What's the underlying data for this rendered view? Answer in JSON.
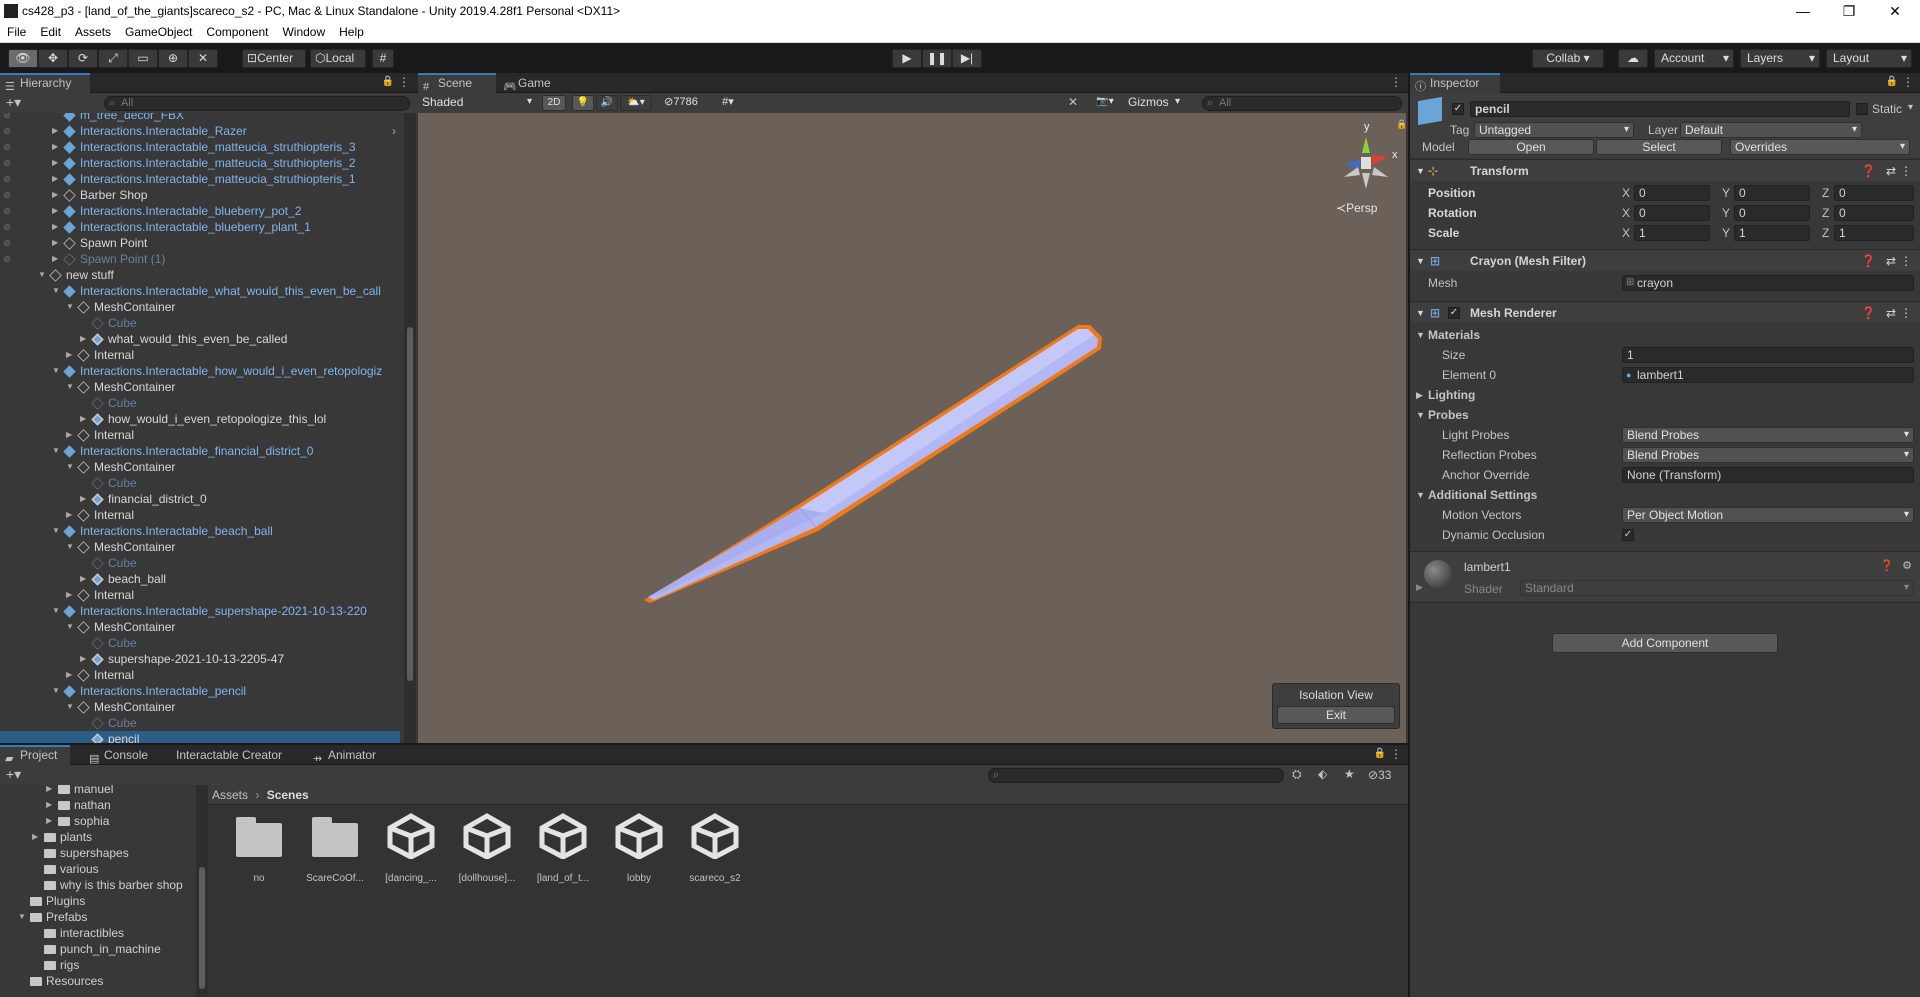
{
  "window": {
    "title": "cs428_p3 - [land_of_the_giants]scareco_s2 - PC, Mac & Linux Standalone - Unity 2019.4.28f1 Personal <DX11>",
    "minimize": "—",
    "maximize": "❐",
    "close": "✕"
  },
  "menu": [
    "File",
    "Edit",
    "Assets",
    "GameObject",
    "Component",
    "Window",
    "Help"
  ],
  "toolbar": {
    "center_label": "Center",
    "local_label": "Local",
    "collab_label": "Collab ▾",
    "account_label": "Account",
    "layers_label": "Layers",
    "layout_label": "Layout"
  },
  "hierarchy": {
    "tab_label": "Hierarchy",
    "search_placeholder": "All",
    "rows": [
      {
        "label": "m_tree_decor_FBX",
        "indent": 1,
        "style": "blue",
        "arrow": "",
        "icon": "prefab"
      },
      {
        "label": "Interactions.Interactable_Razer",
        "indent": 1,
        "style": "blue",
        "arrow": "▶",
        "icon": "prefab"
      },
      {
        "label": "Interactions.Interactable_matteucia_struthiopteris_3",
        "indent": 1,
        "style": "blue",
        "arrow": "▶",
        "icon": "prefab"
      },
      {
        "label": "Interactions.Interactable_matteucia_struthiopteris_2",
        "indent": 1,
        "style": "blue",
        "arrow": "▶",
        "icon": "prefab"
      },
      {
        "label": "Interactions.Interactable_matteucia_struthiopteris_1",
        "indent": 1,
        "style": "blue",
        "arrow": "▶",
        "icon": "prefab"
      },
      {
        "label": "Barber Shop",
        "indent": 1,
        "style": "white",
        "arrow": "▶",
        "icon": "object"
      },
      {
        "label": "Interactions.Interactable_blueberry_pot_2",
        "indent": 1,
        "style": "blue",
        "arrow": "▶",
        "icon": "prefab"
      },
      {
        "label": "Interactions.Interactable_blueberry_plant_1",
        "indent": 1,
        "style": "blue",
        "arrow": "▶",
        "icon": "prefab"
      },
      {
        "label": "Spawn Point",
        "indent": 1,
        "style": "white",
        "arrow": "▶",
        "icon": "object"
      },
      {
        "label": "Spawn Point (1)",
        "indent": 1,
        "style": "disabled",
        "arrow": "▶",
        "icon": "object"
      },
      {
        "label": "new stuff",
        "indent": 0,
        "style": "white",
        "arrow": "▼",
        "icon": "object"
      },
      {
        "label": "Interactions.Interactable_what_would_this_even_be_call",
        "indent": 1,
        "style": "blue",
        "arrow": "▼",
        "icon": "prefab"
      },
      {
        "label": "MeshContainer",
        "indent": 2,
        "style": "white",
        "arrow": "▼",
        "icon": "object"
      },
      {
        "label": "Cube",
        "indent": 3,
        "style": "disabled",
        "arrow": "",
        "icon": "object"
      },
      {
        "label": "what_would_this_even_be_called",
        "indent": 3,
        "style": "white",
        "arrow": "▶",
        "icon": "model"
      },
      {
        "label": "Internal",
        "indent": 2,
        "style": "white",
        "arrow": "▶",
        "icon": "object"
      },
      {
        "label": "Interactions.Interactable_how_would_i_even_retopologiz",
        "indent": 1,
        "style": "blue",
        "arrow": "▼",
        "icon": "prefab"
      },
      {
        "label": "MeshContainer",
        "indent": 2,
        "style": "white",
        "arrow": "▼",
        "icon": "object"
      },
      {
        "label": "Cube",
        "indent": 3,
        "style": "disabled",
        "arrow": "",
        "icon": "object"
      },
      {
        "label": "how_would_i_even_retopologize_this_lol",
        "indent": 3,
        "style": "white",
        "arrow": "▶",
        "icon": "model"
      },
      {
        "label": "Internal",
        "indent": 2,
        "style": "white",
        "arrow": "▶",
        "icon": "object"
      },
      {
        "label": "Interactions.Interactable_financial_district_0",
        "indent": 1,
        "style": "blue",
        "arrow": "▼",
        "icon": "prefab"
      },
      {
        "label": "MeshContainer",
        "indent": 2,
        "style": "white",
        "arrow": "▼",
        "icon": "object"
      },
      {
        "label": "Cube",
        "indent": 3,
        "style": "disabled",
        "arrow": "",
        "icon": "object"
      },
      {
        "label": "financial_district_0",
        "indent": 3,
        "style": "white",
        "arrow": "▶",
        "icon": "model"
      },
      {
        "label": "Internal",
        "indent": 2,
        "style": "white",
        "arrow": "▶",
        "icon": "object"
      },
      {
        "label": "Interactions.Interactable_beach_ball",
        "indent": 1,
        "style": "blue",
        "arrow": "▼",
        "icon": "prefab"
      },
      {
        "label": "MeshContainer",
        "indent": 2,
        "style": "white",
        "arrow": "▼",
        "icon": "object"
      },
      {
        "label": "Cube",
        "indent": 3,
        "style": "disabled",
        "arrow": "",
        "icon": "object"
      },
      {
        "label": "beach_ball",
        "indent": 3,
        "style": "white",
        "arrow": "▶",
        "icon": "model"
      },
      {
        "label": "Internal",
        "indent": 2,
        "style": "white",
        "arrow": "▶",
        "icon": "object"
      },
      {
        "label": "Interactions.Interactable_supershape-2021-10-13-220",
        "indent": 1,
        "style": "blue",
        "arrow": "▼",
        "icon": "prefab"
      },
      {
        "label": "MeshContainer",
        "indent": 2,
        "style": "white",
        "arrow": "▼",
        "icon": "object"
      },
      {
        "label": "Cube",
        "indent": 3,
        "style": "disabled",
        "arrow": "",
        "icon": "object"
      },
      {
        "label": "supershape-2021-10-13-2205-47",
        "indent": 3,
        "style": "white",
        "arrow": "▶",
        "icon": "model"
      },
      {
        "label": "Internal",
        "indent": 2,
        "style": "white",
        "arrow": "▶",
        "icon": "object"
      },
      {
        "label": "Interactions.Interactable_pencil",
        "indent": 1,
        "style": "blue",
        "arrow": "▼",
        "icon": "prefab"
      },
      {
        "label": "MeshContainer",
        "indent": 2,
        "style": "white",
        "arrow": "▼",
        "icon": "object"
      },
      {
        "label": "Cube",
        "indent": 3,
        "style": "disabled",
        "arrow": "",
        "icon": "object"
      },
      {
        "label": "pencil",
        "indent": 3,
        "style": "white",
        "arrow": "",
        "icon": "model"
      }
    ]
  },
  "scene": {
    "tab_scene": "Scene",
    "tab_game": "Game",
    "shading_mode": "Shaded",
    "mode_2d": "2D",
    "hidden_count": "7786",
    "gizmos_label": "Gizmos",
    "search_placeholder": "All",
    "persp_label": "Persp",
    "gizmo_y": "y",
    "gizmo_x": "x",
    "isolation_title": "Isolation View",
    "isolation_exit": "Exit"
  },
  "inspector": {
    "tab_label": "Inspector",
    "object_name": "pencil",
    "static_label": "Static",
    "tag_label": "Tag",
    "tag_value": "Untagged",
    "layer_label": "Layer",
    "layer_value": "Default",
    "model_label": "Model",
    "open_label": "Open",
    "select_label": "Select",
    "overrides_label": "Overrides",
    "transform": {
      "title": "Transform",
      "position_label": "Position",
      "rotation_label": "Rotation",
      "scale_label": "Scale",
      "axis_x": "X",
      "axis_y": "Y",
      "axis_z": "Z",
      "position": [
        "0",
        "0",
        "0"
      ],
      "rotation": [
        "0",
        "0",
        "0"
      ],
      "scale": [
        "1",
        "1",
        "1"
      ]
    },
    "mesh_filter": {
      "title": "Crayon (Mesh Filter)",
      "mesh_label": "Mesh",
      "mesh_value": "crayon"
    },
    "mesh_renderer": {
      "title": "Mesh Renderer",
      "materials_label": "Materials",
      "size_label": "Size",
      "size_value": "1",
      "element0_label": "Element 0",
      "element0_value": "lambert1",
      "lighting_label": "Lighting",
      "probes_label": "Probes",
      "light_probes_label": "Light Probes",
      "light_probes_value": "Blend Probes",
      "reflection_probes_label": "Reflection Probes",
      "reflection_probes_value": "Blend Probes",
      "anchor_override_label": "Anchor Override",
      "anchor_override_value": "None (Transform)",
      "additional_label": "Additional Settings",
      "motion_vectors_label": "Motion Vectors",
      "motion_vectors_value": "Per Object Motion",
      "dynamic_occlusion_label": "Dynamic Occlusion"
    },
    "material": {
      "name": "lambert1",
      "shader_label": "Shader",
      "shader_value": "Standard"
    },
    "add_component": "Add Component"
  },
  "project": {
    "tabs": [
      "Project",
      "Console",
      "Interactable Creator",
      "Animator"
    ],
    "hidden_count": "33",
    "breadcrumb_root": "Assets",
    "breadcrumb_current": "Scenes",
    "folders": [
      {
        "label": "manuel",
        "indent": 2,
        "arrow": "▶"
      },
      {
        "label": "nathan",
        "indent": 2,
        "arrow": "▶"
      },
      {
        "label": "sophia",
        "indent": 2,
        "arrow": "▶"
      },
      {
        "label": "plants",
        "indent": 1,
        "arrow": "▶"
      },
      {
        "label": "supershapes",
        "indent": 1,
        "arrow": ""
      },
      {
        "label": "various",
        "indent": 1,
        "arrow": ""
      },
      {
        "label": "why is this barber shop",
        "indent": 1,
        "arrow": ""
      },
      {
        "label": "Plugins",
        "indent": 0,
        "arrow": ""
      },
      {
        "label": "Prefabs",
        "indent": 0,
        "arrow": "▼"
      },
      {
        "label": "interactibles",
        "indent": 1,
        "arrow": ""
      },
      {
        "label": "punch_in_machine",
        "indent": 1,
        "arrow": ""
      },
      {
        "label": "rigs",
        "indent": 1,
        "arrow": ""
      },
      {
        "label": "Resources",
        "indent": 0,
        "arrow": ""
      }
    ],
    "assets": [
      {
        "label": "no",
        "kind": "folder"
      },
      {
        "label": "ScareCoOf...",
        "kind": "folder"
      },
      {
        "label": "[dancing_...",
        "kind": "scene"
      },
      {
        "label": "[dollhouse]...",
        "kind": "scene"
      },
      {
        "label": "[land_of_t...",
        "kind": "scene"
      },
      {
        "label": "lobby",
        "kind": "scene"
      },
      {
        "label": "scareco_s2",
        "kind": "scene"
      }
    ]
  },
  "colors": {
    "accent": "#3a79bb",
    "prefab_blue": "#7fb6f0",
    "scene_bg": "#6b6159",
    "pencil": "#b3b8f5",
    "selection_outline": "#f07a1a"
  }
}
